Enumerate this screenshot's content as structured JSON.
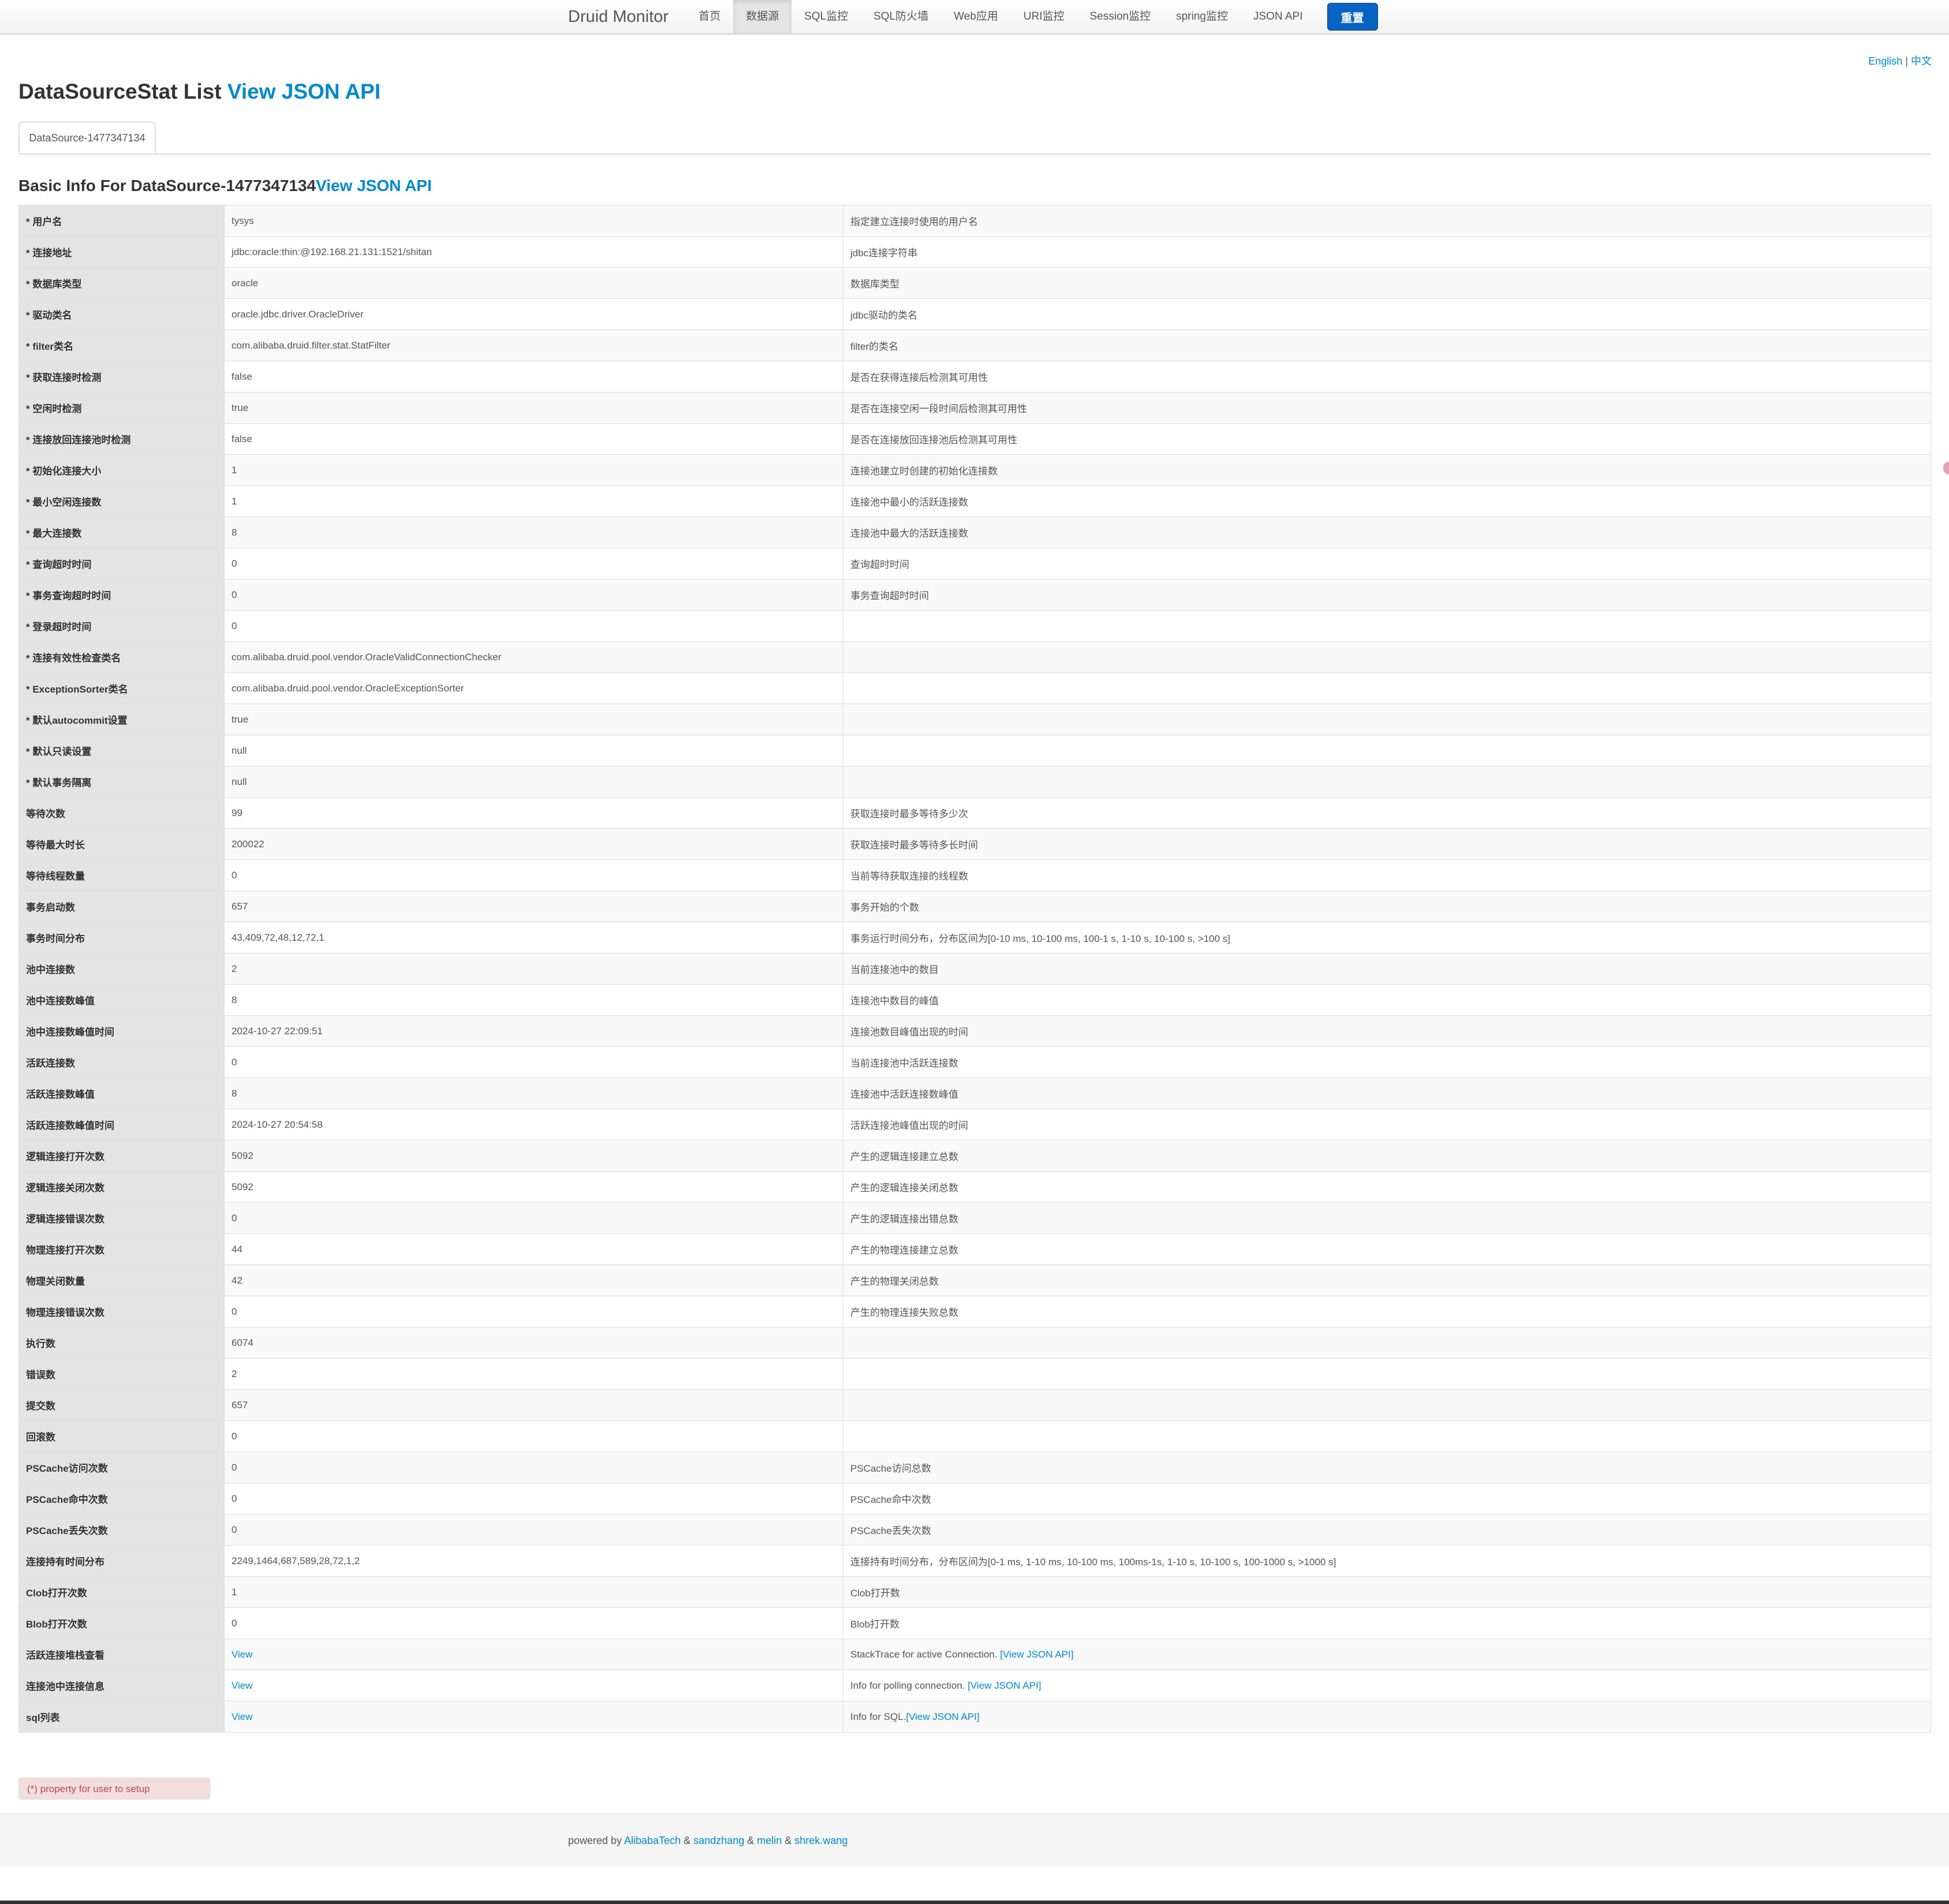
{
  "nav": {
    "brand": "Druid Monitor",
    "items": [
      "首页",
      "数据源",
      "SQL监控",
      "SQL防火墙",
      "Web应用",
      "URI监控",
      "Session监控",
      "spring监控",
      "JSON API"
    ],
    "active_index": 1,
    "reset_label": "重置"
  },
  "lang": {
    "english": "English",
    "separator": "|",
    "chinese": "中文"
  },
  "page": {
    "title": "DataSourceStat List ",
    "title_link": "View JSON API",
    "tab": "DataSource-1477347134",
    "subtitle": "Basic Info For DataSource-1477347134",
    "subtitle_link": "View JSON API"
  },
  "rows": [
    {
      "key": "* 用户名",
      "value": "tysys",
      "desc": "指定建立连接时使用的用户名"
    },
    {
      "key": "* 连接地址",
      "value": "jdbc:oracle:thin:@192.168.21.131:1521/shitan",
      "desc": "jdbc连接字符串"
    },
    {
      "key": "* 数据库类型",
      "value": "oracle",
      "desc": "数据库类型"
    },
    {
      "key": "* 驱动类名",
      "value": "oracle.jdbc.driver.OracleDriver",
      "desc": "jdbc驱动的类名"
    },
    {
      "key": "* filter类名",
      "value": "com.alibaba.druid.filter.stat.StatFilter",
      "desc": "filter的类名"
    },
    {
      "key": "* 获取连接时检测",
      "value": "false",
      "desc": "是否在获得连接后检测其可用性"
    },
    {
      "key": "* 空闲时检测",
      "value": "true",
      "desc": "是否在连接空闲一段时间后检测其可用性"
    },
    {
      "key": "* 连接放回连接池时检测",
      "value": "false",
      "desc": "是否在连接放回连接池后检测其可用性"
    },
    {
      "key": "* 初始化连接大小",
      "value": "1",
      "desc": "连接池建立时创建的初始化连接数"
    },
    {
      "key": "* 最小空闲连接数",
      "value": "1",
      "desc": "连接池中最小的活跃连接数"
    },
    {
      "key": "* 最大连接数",
      "value": "8",
      "desc": "连接池中最大的活跃连接数"
    },
    {
      "key": "* 查询超时时间",
      "value": "0",
      "desc": "查询超时时间"
    },
    {
      "key": "* 事务查询超时时间",
      "value": "0",
      "desc": "事务查询超时时间"
    },
    {
      "key": "* 登录超时时间",
      "value": "0",
      "desc": ""
    },
    {
      "key": "* 连接有效性检查类名",
      "value": "com.alibaba.druid.pool.vendor.OracleValidConnectionChecker",
      "desc": ""
    },
    {
      "key": "* ExceptionSorter类名",
      "value": "com.alibaba.druid.pool.vendor.OracleExceptionSorter",
      "desc": ""
    },
    {
      "key": "* 默认autocommit设置",
      "value": "true",
      "desc": ""
    },
    {
      "key": "* 默认只读设置",
      "value": "null",
      "desc": ""
    },
    {
      "key": "* 默认事务隔离",
      "value": "null",
      "desc": ""
    },
    {
      "key": "等待次数",
      "value": "99",
      "desc": "获取连接时最多等待多少次"
    },
    {
      "key": "等待最大时长",
      "value": "200022",
      "desc": "获取连接时最多等待多长时间"
    },
    {
      "key": "等待线程数量",
      "value": "0",
      "desc": "当前等待获取连接的线程数"
    },
    {
      "key": "事务启动数",
      "value": "657",
      "desc": "事务开始的个数"
    },
    {
      "key": "事务时间分布",
      "value": "43,409,72,48,12,72,1",
      "desc": "事务运行时间分布，分布区间为[0-10 ms, 10-100 ms, 100-1 s, 1-10 s, 10-100 s, >100 s]"
    },
    {
      "key": "池中连接数",
      "value": "2",
      "desc": "当前连接池中的数目"
    },
    {
      "key": "池中连接数峰值",
      "value": "8",
      "desc": "连接池中数目的峰值"
    },
    {
      "key": "池中连接数峰值时间",
      "value": "2024-10-27 22:09:51",
      "desc": "连接池数目峰值出现的时间"
    },
    {
      "key": "活跃连接数",
      "value": "0",
      "desc": "当前连接池中活跃连接数"
    },
    {
      "key": "活跃连接数峰值",
      "value": "8",
      "desc": "连接池中活跃连接数峰值"
    },
    {
      "key": "活跃连接数峰值时间",
      "value": "2024-10-27 20:54:58",
      "desc": "活跃连接池峰值出现的时间"
    },
    {
      "key": "逻辑连接打开次数",
      "value": "5092",
      "desc": "产生的逻辑连接建立总数"
    },
    {
      "key": "逻辑连接关闭次数",
      "value": "5092",
      "desc": "产生的逻辑连接关闭总数"
    },
    {
      "key": "逻辑连接错误次数",
      "value": "0",
      "desc": "产生的逻辑连接出错总数"
    },
    {
      "key": "物理连接打开次数",
      "value": "44",
      "desc": "产生的物理连接建立总数"
    },
    {
      "key": "物理关闭数量",
      "value": "42",
      "desc": "产生的物理关闭总数"
    },
    {
      "key": "物理连接错误次数",
      "value": "0",
      "desc": "产生的物理连接失败总数"
    },
    {
      "key": "执行数",
      "value": "6074",
      "desc": ""
    },
    {
      "key": "错误数",
      "value": "2",
      "desc": ""
    },
    {
      "key": "提交数",
      "value": "657",
      "desc": ""
    },
    {
      "key": "回滚数",
      "value": "0",
      "desc": ""
    },
    {
      "key": "PSCache访问次数",
      "value": "0",
      "desc": "PSCache访问总数"
    },
    {
      "key": "PSCache命中次数",
      "value": "0",
      "desc": "PSCache命中次数"
    },
    {
      "key": "PSCache丢失次数",
      "value": "0",
      "desc": "PSCache丢失次数"
    },
    {
      "key": "连接持有时间分布",
      "value": "2249,1464,687,589,28,72,1,2",
      "desc": "连接持有时间分布，分布区间为[0-1 ms, 1-10 ms, 10-100 ms, 100ms-1s, 1-10 s, 10-100 s, 100-1000 s, >1000 s]"
    },
    {
      "key": "Clob打开次数",
      "value": "1",
      "desc": "Clob打开数"
    },
    {
      "key": "Blob打开次数",
      "value": "0",
      "desc": "Blob打开数"
    },
    {
      "key": "活跃连接堆栈查看",
      "value": "View",
      "desc": "StackTrace for active Connection. ",
      "desc_link": "[View JSON API]",
      "value_is_link": true
    },
    {
      "key": "连接池中连接信息",
      "value": "View",
      "desc": "Info for polling connection. ",
      "desc_link": "[View JSON API]",
      "value_is_link": true
    },
    {
      "key": "sql列表",
      "value": "View",
      "desc": "Info for SQL.",
      "desc_link": "[View JSON API]",
      "value_is_link": true
    }
  ],
  "note": "(*) property for user to setup",
  "footer": {
    "prefix": "powered by ",
    "authors": [
      "AlibabaTech",
      "sandzhang",
      "melin",
      "shrek.wang"
    ],
    "separator": " & "
  },
  "colors": {
    "link": "#0088cc",
    "accent_button": "#0a62c4",
    "note_bg": "#f2dede",
    "note_text": "#b94a48",
    "edge_marks": "#e8a0b8"
  }
}
